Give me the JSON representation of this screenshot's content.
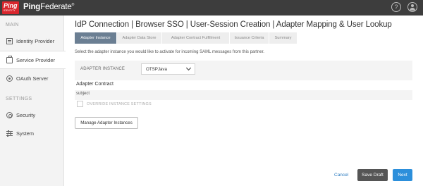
{
  "topbar": {
    "logo_text": "Ping",
    "logo_subtext": "IDENTITY",
    "product_prefix": "Ping",
    "product_suffix": "Federate",
    "product_mark": "®",
    "help_glyph": "?",
    "icons": {
      "help": "help-circle-icon",
      "user": "user-circle-icon"
    }
  },
  "sidebar": {
    "main_heading": "MAIN",
    "settings_heading": "SETTINGS",
    "items": [
      {
        "label": "Identity Provider",
        "icon": "identity-provider-icon",
        "active": false
      },
      {
        "label": "Service Provider",
        "icon": "service-provider-icon",
        "active": true
      },
      {
        "label": "OAuth Server",
        "icon": "oauth-icon",
        "active": false
      },
      {
        "label": "Security",
        "icon": "security-icon",
        "active": false
      },
      {
        "label": "System",
        "icon": "system-icon",
        "active": false
      }
    ]
  },
  "main": {
    "title": "IdP Connection | Browser SSO | User-Session Creation | Adapter Mapping & User Lookup",
    "tabs": [
      {
        "label": "Adapter Instance",
        "active": true
      },
      {
        "label": "Adapter Data Store",
        "active": false
      },
      {
        "label": "Adapter Contract Fulfillment",
        "active": false
      },
      {
        "label": "Issuance Criteria",
        "active": false
      },
      {
        "label": "Summary",
        "active": false
      }
    ],
    "instructions": "Select the adapter instance you would like to activate for incoming SAML messages from this partner.",
    "adapter_instance_label": "ADAPTER INSTANCE",
    "adapter_instance_value": "OTSPJava",
    "adapter_contract_heading": "Adapter Contract",
    "adapter_contract_rows": [
      "subject"
    ],
    "override_label": "OVERRIDE INSTANCE SETTINGS",
    "override_checked": false,
    "manage_button": "Manage Adapter Instances"
  },
  "footer": {
    "cancel": "Cancel",
    "save_draft": "Save Draft",
    "next": "Next"
  },
  "colors": {
    "topbar": "#3d3d3d",
    "brand_red": "#d8262d",
    "active_tab": "#6b7f93",
    "primary": "#2c8fdb",
    "link": "#2b7bc0"
  }
}
